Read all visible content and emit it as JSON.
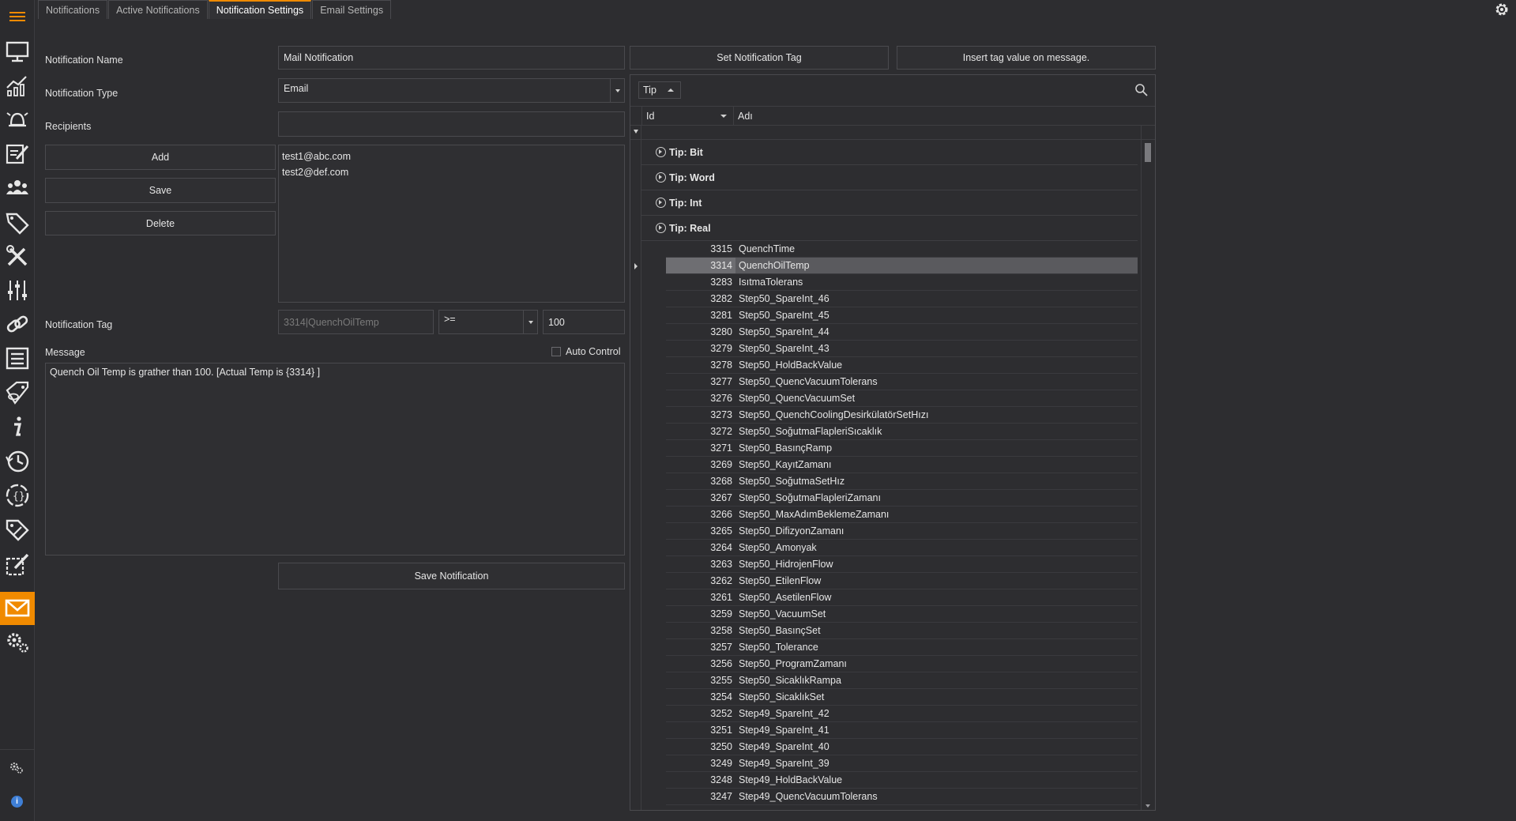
{
  "tabs": [
    {
      "label": "Notifications",
      "active": false
    },
    {
      "label": "Active Notifications",
      "active": false
    },
    {
      "label": "Notification Settings",
      "active": true
    },
    {
      "label": "Email Settings",
      "active": false
    }
  ],
  "sidebar": {
    "items": [
      {
        "icon": "monitor-icon"
      },
      {
        "icon": "chart-icon"
      },
      {
        "icon": "alarm-bell-icon"
      },
      {
        "icon": "edit-form-icon"
      },
      {
        "icon": "users-icon"
      },
      {
        "icon": "tags-icon"
      },
      {
        "icon": "tools-icon"
      },
      {
        "icon": "sliders-icon"
      },
      {
        "icon": "link-icon"
      },
      {
        "icon": "list-icon"
      },
      {
        "icon": "tag-view-icon"
      },
      {
        "icon": "info-icon"
      },
      {
        "icon": "history-icon"
      },
      {
        "icon": "script-icon"
      },
      {
        "icon": "tag-edit-icon"
      },
      {
        "icon": "report-edit-icon"
      },
      {
        "icon": "mail-icon",
        "active": true
      },
      {
        "icon": "settings-gears-icon"
      }
    ],
    "bottom": [
      {
        "icon": "small-gears-icon"
      },
      {
        "icon": "about-info-icon"
      }
    ],
    "accent": "#f08a00"
  },
  "form": {
    "notification_name_label": "Notification Name",
    "notification_name_value": "Mail Notification",
    "notification_type_label": "Notification Type",
    "notification_type_value": "Email",
    "recipients_label": "Recipients",
    "recipients_input": "",
    "add_label": "Add",
    "save_label": "Save",
    "delete_label": "Delete",
    "recipients": [
      "test1@abc.com",
      "test2@def.com"
    ],
    "notification_tag_label": "Notification Tag",
    "notification_tag_value": "3314|QuenchOilTemp",
    "operator_value": ">=",
    "threshold_value": "100",
    "message_label": "Message",
    "auto_control_label": "Auto Control",
    "auto_control_checked": false,
    "message_value": "Quench Oil Temp is grather than 100. [Actual Temp is {3314} ]",
    "save_notification_label": "Save Notification"
  },
  "tag_panel": {
    "set_tag_label": "Set Notification Tag",
    "insert_tag_label": "Insert tag value on message.",
    "group_by_label": "Tip",
    "columns": [
      "Id",
      "Adı"
    ],
    "groups": [
      "Tip: Bit",
      "Tip: Word",
      "Tip: Int",
      "Tip: Real"
    ],
    "selected_id": "3314",
    "rows": [
      {
        "id": "3315",
        "name": "QuenchTime"
      },
      {
        "id": "3314",
        "name": "QuenchOilTemp"
      },
      {
        "id": "3283",
        "name": "IsıtmaTolerans"
      },
      {
        "id": "3282",
        "name": "Step50_SpareInt_46"
      },
      {
        "id": "3281",
        "name": "Step50_SpareInt_45"
      },
      {
        "id": "3280",
        "name": "Step50_SpareInt_44"
      },
      {
        "id": "3279",
        "name": "Step50_SpareInt_43"
      },
      {
        "id": "3278",
        "name": "Step50_HoldBackValue"
      },
      {
        "id": "3277",
        "name": "Step50_QuencVacuumTolerans"
      },
      {
        "id": "3276",
        "name": "Step50_QuencVacuumSet"
      },
      {
        "id": "3273",
        "name": "Step50_QuenchCoolingDesirkülatörSetHızı"
      },
      {
        "id": "3272",
        "name": "Step50_SoğutmaFlapleriSıcaklık"
      },
      {
        "id": "3271",
        "name": "Step50_BasınçRamp"
      },
      {
        "id": "3269",
        "name": "Step50_KayıtZamanı"
      },
      {
        "id": "3268",
        "name": "Step50_SoğutmaSetHız"
      },
      {
        "id": "3267",
        "name": "Step50_SoğutmaFlapleriZamanı"
      },
      {
        "id": "3266",
        "name": "Step50_MaxAdımBeklemeZamanı"
      },
      {
        "id": "3265",
        "name": "Step50_DifizyonZamanı"
      },
      {
        "id": "3264",
        "name": "Step50_Amonyak"
      },
      {
        "id": "3263",
        "name": "Step50_HidrojenFlow"
      },
      {
        "id": "3262",
        "name": "Step50_EtilenFlow"
      },
      {
        "id": "3261",
        "name": "Step50_AsetilenFlow"
      },
      {
        "id": "3259",
        "name": "Step50_VacuumSet"
      },
      {
        "id": "3258",
        "name": "Step50_BasınçSet"
      },
      {
        "id": "3257",
        "name": "Step50_Tolerance"
      },
      {
        "id": "3256",
        "name": "Step50_ProgramZamanı"
      },
      {
        "id": "3255",
        "name": "Step50_SicaklıkRampa"
      },
      {
        "id": "3254",
        "name": "Step50_SicaklıkSet"
      },
      {
        "id": "3252",
        "name": "Step49_SpareInt_42"
      },
      {
        "id": "3251",
        "name": "Step49_SpareInt_41"
      },
      {
        "id": "3250",
        "name": "Step49_SpareInt_40"
      },
      {
        "id": "3249",
        "name": "Step49_SpareInt_39"
      },
      {
        "id": "3248",
        "name": "Step49_HoldBackValue"
      },
      {
        "id": "3247",
        "name": "Step49_QuencVacuumTolerans"
      }
    ]
  }
}
